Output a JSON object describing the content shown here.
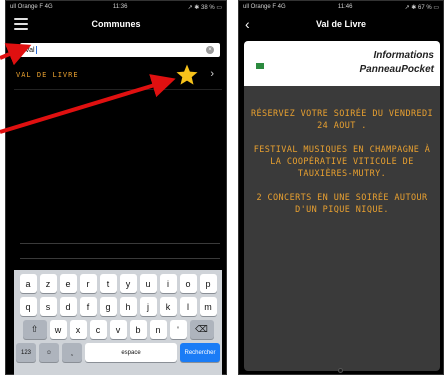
{
  "left_phone": {
    "status": {
      "carrier": "ull Orange F 4G",
      "time": "11:36",
      "battery": "↗ ✱ 38 % ▭"
    },
    "title": "Communes",
    "search": {
      "value": "Val",
      "clear_glyph": "×"
    },
    "result": {
      "label": "VAL DE LIVRE",
      "favorite_icon": "star-icon",
      "chevron": "›"
    },
    "keyboard": {
      "row1": [
        "a",
        "z",
        "e",
        "r",
        "t",
        "y",
        "u",
        "i",
        "o",
        "p"
      ],
      "row2": [
        "q",
        "s",
        "d",
        "f",
        "g",
        "h",
        "j",
        "k",
        "l",
        "m"
      ],
      "row3": [
        "w",
        "x",
        "c",
        "v",
        "b",
        "n",
        "'"
      ],
      "shift": "⇧",
      "backspace": "⌫",
      "num": "123",
      "emoji": "☺",
      "mic": "̰",
      "space": "espace",
      "enter": "Rechercher"
    }
  },
  "right_phone": {
    "status": {
      "carrier": "ull Orange F 4G",
      "time": "11:46",
      "battery": "↗ ✱ 67 % ▭"
    },
    "title": "Val de Livre",
    "back": "‹",
    "card": {
      "title_line1": "Informations",
      "title_line2": "PanneauPocket",
      "paragraphs": [
        "RÉSERVEZ VOTRE SOIRÉE DU VENDREDI 24 AOUT .",
        "FESTIVAL MUSIQUES EN CHAMPAGNE À LA COOPÉRATIVE VITICOLE DE TAUXIÈRES-MUTRY.",
        "2 CONCERTS EN UNE SOIRÉE AUTOUR D'UN PIQUE NIQUE."
      ]
    }
  },
  "colors": {
    "accent": "#e8a030",
    "arrow": "#e01010",
    "star": "#f6c21b",
    "enter_key": "#1a7cf6"
  }
}
